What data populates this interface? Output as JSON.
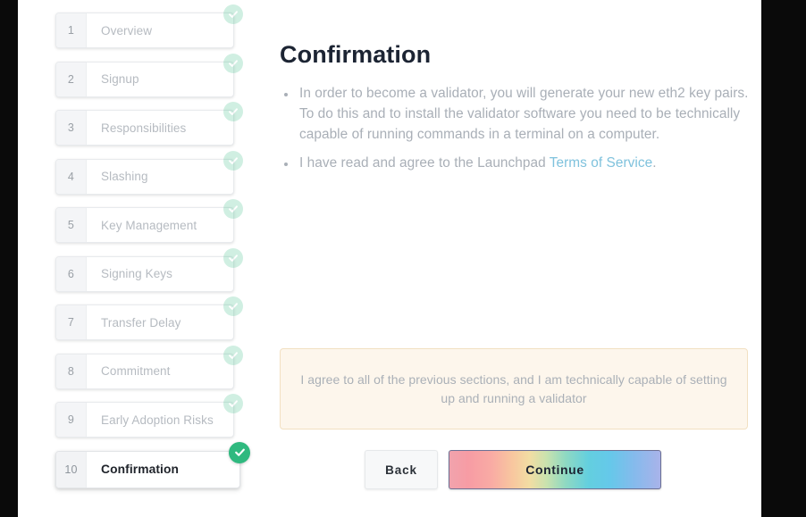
{
  "stepper": {
    "steps": [
      {
        "number": "1",
        "label": "Overview",
        "state": "complete"
      },
      {
        "number": "2",
        "label": "Signup",
        "state": "complete"
      },
      {
        "number": "3",
        "label": "Responsibilities",
        "state": "complete"
      },
      {
        "number": "4",
        "label": "Slashing",
        "state": "complete"
      },
      {
        "number": "5",
        "label": "Key Management",
        "state": "complete"
      },
      {
        "number": "6",
        "label": "Signing Keys",
        "state": "complete"
      },
      {
        "number": "7",
        "label": "Transfer Delay",
        "state": "complete"
      },
      {
        "number": "8",
        "label": "Commitment",
        "state": "complete"
      },
      {
        "number": "9",
        "label": "Early Adoption Risks",
        "state": "complete"
      },
      {
        "number": "10",
        "label": "Confirmation",
        "state": "active"
      }
    ],
    "check_icon": "check-icon"
  },
  "main": {
    "title": "Confirmation",
    "bullets": [
      {
        "text": "In order to become a validator, you will generate your new eth2 key pairs. To do this and to install the validator software you need to be technically capable of running commands in a terminal on a computer."
      },
      {
        "text_before": "I have read and agree to the Launchpad ",
        "link_text": "Terms of Service",
        "text_after": "."
      }
    ],
    "agreement_notice": "I agree to all of the previous sections, and I am technically capable of setting up and running a validator",
    "buttons": {
      "back_label": "Back",
      "continue_label": "Continue"
    }
  },
  "colors": {
    "title": "#1c2433",
    "body_text": "#a9afb7",
    "link": "#7fc2dd",
    "check_green": "#2fb97f",
    "notice_background": "#fdf6ec",
    "notice_border": "#f2e0c2",
    "continue_gradient_start": "#f1a3ad",
    "continue_gradient_end": "#a9b3ea"
  }
}
